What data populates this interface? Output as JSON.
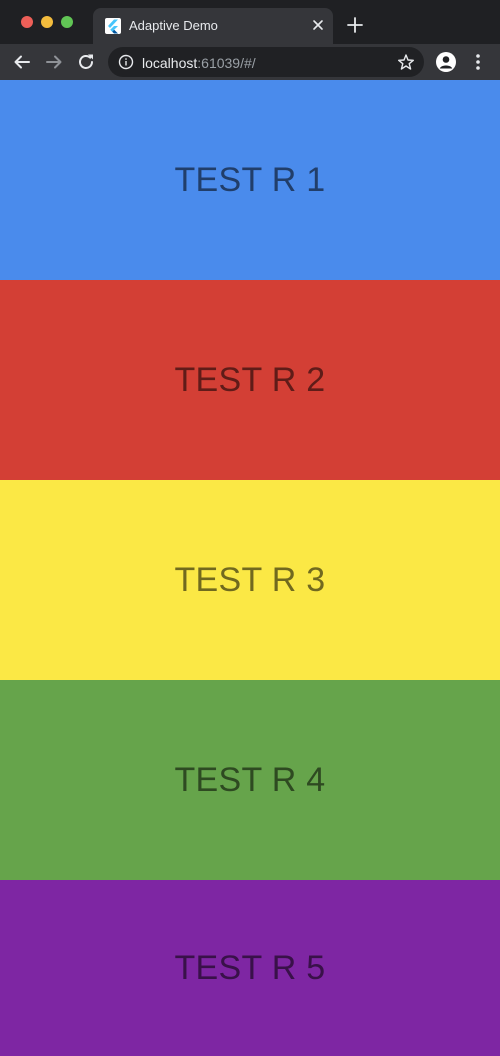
{
  "browser": {
    "tab": {
      "title": "Adaptive Demo",
      "favicon": "flutter-icon"
    },
    "new_tab_icon": "plus-icon",
    "toolbar": {
      "back_icon": "arrow-left-icon",
      "forward_icon": "arrow-right-icon",
      "reload_icon": "reload-icon",
      "info_icon": "info-icon",
      "url_host": "localhost",
      "url_rest": ":61039/#/",
      "bookmark_icon": "star-icon",
      "profile_icon": "person-icon",
      "menu_icon": "kebab-icon"
    }
  },
  "panels": [
    {
      "label": "TEST R 1",
      "color": "#4a8bec"
    },
    {
      "label": "TEST R 2",
      "color": "#d33f35"
    },
    {
      "label": "TEST R 3",
      "color": "#fbe845"
    },
    {
      "label": "TEST R 4",
      "color": "#66a44b"
    },
    {
      "label": "TEST R 5",
      "color": "#7e26a3"
    }
  ]
}
